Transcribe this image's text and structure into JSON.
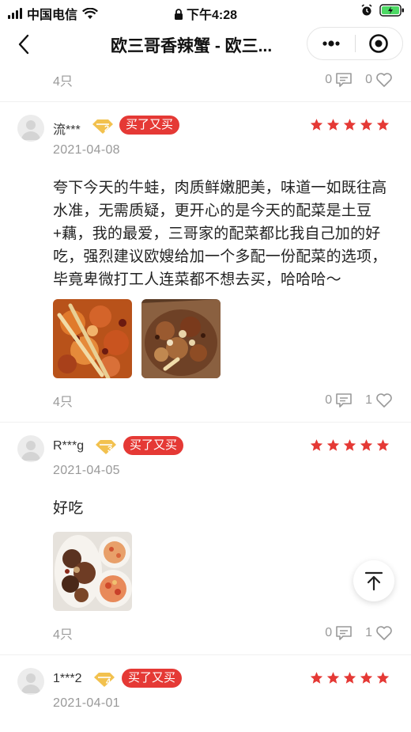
{
  "status_bar": {
    "carrier": "中国电信",
    "time": "下午4:28",
    "icons": [
      "signal-icon",
      "wifi-icon",
      "lock-icon",
      "alarm-icon",
      "battery-icon"
    ]
  },
  "nav": {
    "title": "欧三哥香辣蟹 - 欧三...",
    "more_icon": "more-dots-icon",
    "close_icon": "target-icon"
  },
  "prev_meta": {
    "portion": "4只",
    "comments": "0",
    "likes": "0"
  },
  "reviews": [
    {
      "user": "流***",
      "level": "2",
      "tag": "买了又买",
      "stars": 5,
      "date": "2021-04-08",
      "text": "夸下今天的牛蛙，肉质鲜嫩肥美，味道一如既往高水准，无需质疑，更开心的是今天的配菜是土豆+藕，我的最爱，三哥家的配菜都比我自己加的好吃，强烈建议欧嫂给加一个多配一份配菜的选项，毕竟卑微打工人连菜都不想去买，哈哈哈～",
      "photos": [
        "spicy-frog-photo",
        "spicy-crab-photo"
      ],
      "portion": "4只",
      "comments": "0",
      "likes": "1"
    },
    {
      "user": "R***g",
      "level": "3",
      "tag": "买了又买",
      "stars": 5,
      "date": "2021-04-05",
      "text": "好吃",
      "photos": [
        "meal-plate-photo"
      ],
      "portion": "4只",
      "comments": "0",
      "likes": "1"
    },
    {
      "user": "1***2",
      "level": "4",
      "tag": "买了又买",
      "stars": 5,
      "date": "2021-04-01"
    }
  ],
  "colors": {
    "star": "#e53935",
    "tag_bg": "#e53935",
    "badge": "#f2c14e",
    "muted": "#999999"
  },
  "back_to_top_icon": "arrow-up-icon"
}
